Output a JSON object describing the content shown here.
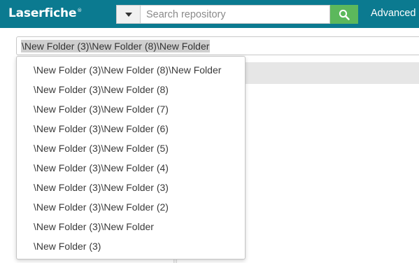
{
  "header": {
    "logo_text": "Laserfiche",
    "logo_mark": "®",
    "search": {
      "placeholder": "Search repository",
      "value": ""
    },
    "advanced_label": "Advanced",
    "colors": {
      "bar": "#0b7a90",
      "search_button": "#5cb85c"
    }
  },
  "path_bar": {
    "value": "\\New Folder (3)\\New Folder (8)\\New Folder"
  },
  "path_dropdown": {
    "options": [
      "\\New Folder (3)\\New Folder (8)\\New Folder",
      "\\New Folder (3)\\New Folder (8)",
      "\\New Folder (3)\\New Folder (7)",
      "\\New Folder (3)\\New Folder (6)",
      "\\New Folder (3)\\New Folder (5)",
      "\\New Folder (3)\\New Folder (4)",
      "\\New Folder (3)\\New Folder (3)",
      "\\New Folder (3)\\New Folder (2)",
      "\\New Folder (3)\\New Folder",
      "\\New Folder (3)"
    ]
  },
  "icons": {
    "scope": "chevron-down-icon",
    "search": "search-icon"
  }
}
